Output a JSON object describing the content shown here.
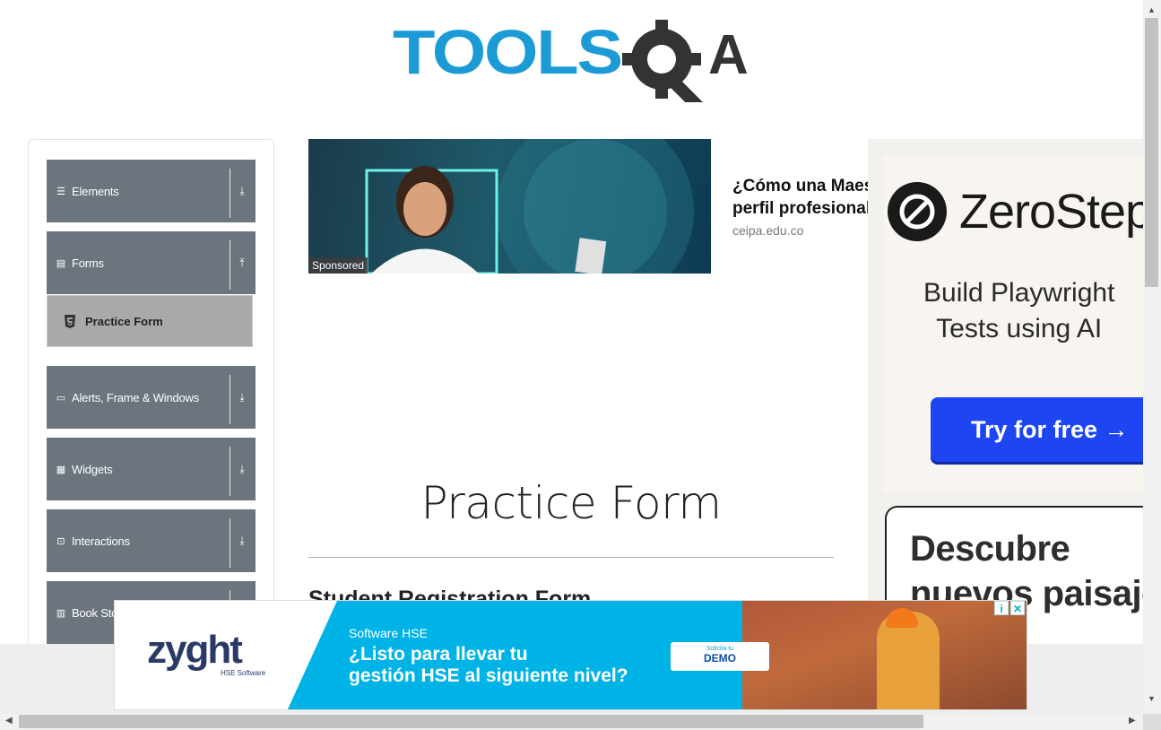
{
  "header": {
    "logo_alt": "TOOLSQA",
    "logo_text_part": "TOOLS",
    "logo_text_end": "A"
  },
  "sidebar": {
    "groups": [
      {
        "label": "Elements",
        "icon": "hamburger-icon",
        "arrow": "download-icon"
      },
      {
        "label": "Forms",
        "icon": "document-icon",
        "arrow": "upload-icon"
      },
      {
        "label": "Alerts, Frame & Windows",
        "icon": "window-icon",
        "arrow": "download-icon"
      },
      {
        "label": "Widgets",
        "icon": "grid-icon",
        "arrow": "download-icon"
      },
      {
        "label": "Interactions",
        "icon": "interaction-icon",
        "arrow": "download-icon"
      },
      {
        "label": "Book Store Application",
        "icon": "books-icon",
        "arrow": "download-icon"
      }
    ],
    "active_item": {
      "label": "Practice Form",
      "icon": "html5-icon"
    }
  },
  "ad_top": {
    "badge": "Sponsored",
    "headline_line1": "¿Cómo una Maestría eleva tu",
    "headline_line2": "perfil profesional?",
    "source": "ceipa.edu.co"
  },
  "main": {
    "title": "Practice Form",
    "form_heading": "Student Registration Form"
  },
  "ad_right": {
    "brand": "ZeroStep",
    "tagline_line1": "Build Playwright",
    "tagline_line2": "Tests using AI",
    "cta": "Try for free →",
    "card_line1": "Descubre",
    "card_line2": "nuevos paisajes"
  },
  "ad_bottom": {
    "brand": "zyght",
    "brand_sub": "HSE Software",
    "kicker": "Software HSE",
    "question_line1": "¿Listo para llevar tu",
    "question_line2": "gestión HSE al siguiente nivel?",
    "demo_small": "Solicita tu",
    "demo_big": "DEMO",
    "info": "i",
    "close": "✕"
  },
  "colors": {
    "sidebar_group": "#6c757d",
    "active_item": "#a9a9a9",
    "logo_blue": "#1b9ad6",
    "logo_dark": "#333333",
    "zerostep_button": "#1d46f2",
    "zyght_banner": "#00b3e6"
  }
}
